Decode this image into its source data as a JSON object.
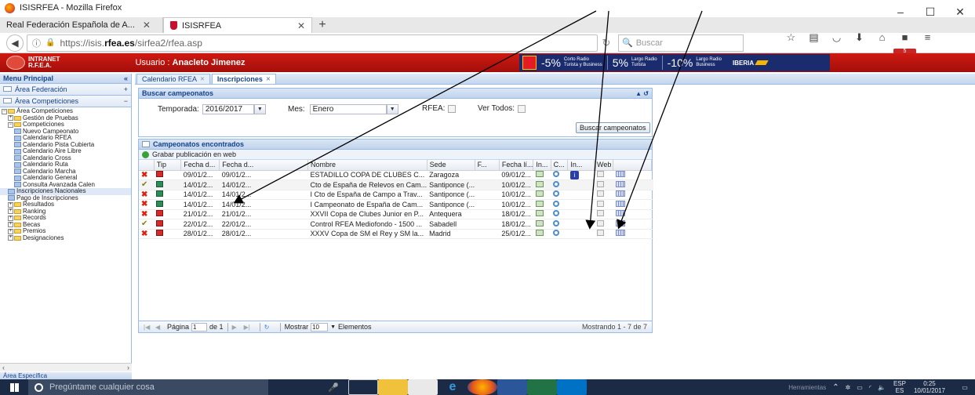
{
  "browser": {
    "window_title": "ISISRFEA - Mozilla Firefox",
    "tabs": [
      {
        "label": "Real Federación Española de A..."
      },
      {
        "label": "ISISRFEA"
      }
    ],
    "url_prefix": "https://isis.",
    "url_domain": "rfea.es",
    "url_path": "/sirfea2/rfea.asp",
    "search_placeholder": "Buscar",
    "notification_count": "5"
  },
  "app": {
    "logo_line1": "INTRANET",
    "logo_line2": "R.F.E.A.",
    "user_label": "Usuario :",
    "user_name": "Anacleto Jimenez",
    "banner": {
      "offer1_pct": "-5%",
      "offer1_text1": "Corto Radio",
      "offer1_text2": "Turista y Business",
      "offer2_pct": "5%",
      "offer2_text1": "Largo Radio",
      "offer2_text2": "Turista",
      "offer3_pct": "-10%",
      "offer3_text1": "Largo Radio",
      "offer3_text2": "Business",
      "brand": "IBERIA"
    }
  },
  "sidebar": {
    "title": "Menu Principal",
    "sections": [
      {
        "label": "Área Federación"
      },
      {
        "label": "Área Competiciones"
      }
    ],
    "tree": [
      {
        "label": "Área Competiciones",
        "level": 0,
        "type": "folder"
      },
      {
        "label": "Gestión de Pruebas",
        "level": 1,
        "type": "folder"
      },
      {
        "label": "Competiciones",
        "level": 1,
        "type": "folder"
      },
      {
        "label": "Nuevo Campeonato",
        "level": 2,
        "type": "leaf"
      },
      {
        "label": "Calendario RFEA",
        "level": 2,
        "type": "leaf"
      },
      {
        "label": "Calendario Pista Cubierta",
        "level": 2,
        "type": "leaf"
      },
      {
        "label": "Calendario Aire Libre",
        "level": 2,
        "type": "leaf"
      },
      {
        "label": "Calendario Cross",
        "level": 2,
        "type": "leaf"
      },
      {
        "label": "Calendario Ruta",
        "level": 2,
        "type": "leaf"
      },
      {
        "label": "Calendario Marcha",
        "level": 2,
        "type": "leaf"
      },
      {
        "label": "Calendario General",
        "level": 2,
        "type": "leaf"
      },
      {
        "label": "Consulta Avanzada Calen",
        "level": 2,
        "type": "leaf"
      },
      {
        "label": "Inscripciones Nacionales",
        "level": 1,
        "type": "leaf",
        "selected": true
      },
      {
        "label": "Pago de Inscripciones",
        "level": 1,
        "type": "leaf"
      },
      {
        "label": "Resultados",
        "level": 1,
        "type": "folder"
      },
      {
        "label": "Ranking",
        "level": 1,
        "type": "folder"
      },
      {
        "label": "Records",
        "level": 1,
        "type": "folder"
      },
      {
        "label": "Becas",
        "level": 1,
        "type": "folder"
      },
      {
        "label": "Premios",
        "level": 1,
        "type": "folder"
      },
      {
        "label": "Designaciones",
        "level": 1,
        "type": "folder"
      }
    ],
    "bottom_label": "Área Específica"
  },
  "main": {
    "tabs": [
      {
        "label": "Calendario RFEA"
      },
      {
        "label": "Inscripciones"
      }
    ],
    "search_panel": {
      "title": "Buscar campeonatos",
      "temporada_label": "Temporada:",
      "temporada_value": "2016/2017",
      "mes_label": "Mes:",
      "mes_value": "Enero",
      "rfea_label": "RFEA:",
      "ver_todos_label": "Ver Todos:",
      "search_button": "Buscar campeonatos"
    },
    "results_panel": {
      "title": "Campeonatos encontrados",
      "publish_label": "Grabar publicación en web",
      "columns": [
        "Tip",
        "Fecha d...",
        "Fecha d...",
        "Nombre",
        "Sede",
        "F...",
        "Fecha lí...",
        "In...",
        "C...",
        "In...",
        "Web"
      ],
      "rows": [
        {
          "status": "x",
          "type": "red",
          "fecha1": "09/01/2...",
          "fecha2": "09/01/2...",
          "nombre": "ESTADILLO COPA DE CLUBES C...",
          "sede": "Zaragoza",
          "fecha_lim": "09/01/2...",
          "info": true
        },
        {
          "status": "ok",
          "type": "green",
          "fecha1": "14/01/2...",
          "fecha2": "14/01/2...",
          "nombre": "Cto de España de Relevos en Cam...",
          "sede": "Santiponce (...",
          "fecha_lim": "10/01/2...",
          "info": false
        },
        {
          "status": "x",
          "type": "green",
          "fecha1": "14/01/2...",
          "fecha2": "14/01/2...",
          "nombre": "I Cto de España de Campo a Trav...",
          "sede": "Santiponce (...",
          "fecha_lim": "10/01/2...",
          "info": false
        },
        {
          "status": "x",
          "type": "green",
          "fecha1": "14/01/2...",
          "fecha2": "14/01/2...",
          "nombre": "I Campeonato de España de Cam...",
          "sede": "Santiponce (...",
          "fecha_lim": "10/01/2...",
          "info": false
        },
        {
          "status": "x",
          "type": "red",
          "fecha1": "21/01/2...",
          "fecha2": "21/01/2...",
          "nombre": "XXVII Copa de Clubes Junior en P...",
          "sede": "Antequera",
          "fecha_lim": "18/01/2...",
          "info": false
        },
        {
          "status": "ok",
          "type": "red",
          "fecha1": "22/01/2...",
          "fecha2": "22/01/2...",
          "nombre": "Control RFEA Mediofondo - 1500 ...",
          "sede": "Sabadell",
          "fecha_lim": "18/01/2...",
          "info": false
        },
        {
          "status": "x",
          "type": "red",
          "fecha1": "28/01/2...",
          "fecha2": "28/01/2...",
          "nombre": "XXXV Copa de SM el Rey y SM la...",
          "sede": "Madrid",
          "fecha_lim": "25/01/2...",
          "info": false
        }
      ],
      "pager": {
        "page_label": "Página",
        "page_value": "1",
        "of_label": "de 1",
        "show_label": "Mostrar",
        "show_value": "10",
        "elements_label": "Elementos",
        "summary": "Mostrando 1 - 7 de 7"
      }
    }
  },
  "taskbar": {
    "search_placeholder": "Pregúntame cualquier cosa",
    "tray_label": "Herramientas",
    "lang_top": "ESP",
    "lang_bottom": "ES",
    "time": "0:25",
    "date": "10/01/2017"
  }
}
